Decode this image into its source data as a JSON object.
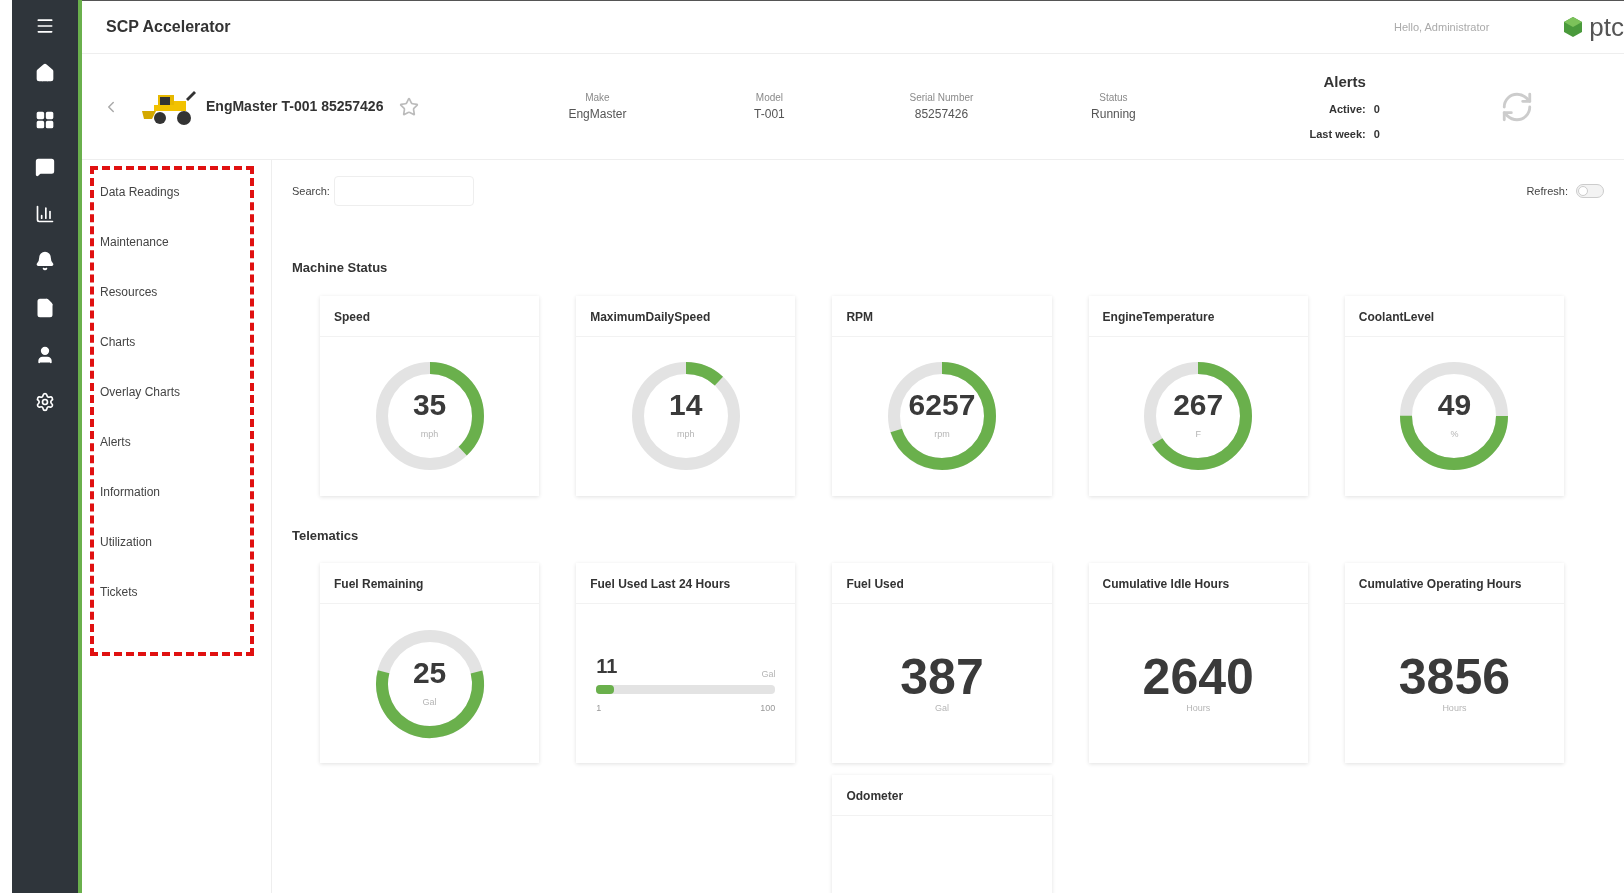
{
  "app": {
    "title": "SCP Accelerator",
    "greeting": "Hello, Administrator",
    "logo_text": "ptc"
  },
  "asset": {
    "name": "EngMaster T-001 85257426",
    "favorite": false,
    "fields": [
      {
        "label": "Make",
        "value": "EngMaster"
      },
      {
        "label": "Model",
        "value": "T-001"
      },
      {
        "label": "Serial Number",
        "value": "85257426"
      },
      {
        "label": "Status",
        "value": "Running"
      }
    ]
  },
  "alerts": {
    "title": "Alerts",
    "rows": [
      {
        "label": "Active:",
        "value": "0"
      },
      {
        "label": "Last week:",
        "value": "0"
      }
    ]
  },
  "menu": [
    "Data Readings",
    "Maintenance",
    "Resources",
    "Charts",
    "Overlay Charts",
    "Alerts",
    "Information",
    "Utilization",
    "Tickets"
  ],
  "search": {
    "label": "Search:"
  },
  "refresh": {
    "label": "Refresh:",
    "on": false
  },
  "sections": [
    {
      "title": "Machine Status",
      "cards": [
        {
          "kind": "ring",
          "title": "Speed",
          "value": "35",
          "unit": "mph",
          "level": 0.38
        },
        {
          "kind": "ring",
          "title": "MaximumDailySpeed",
          "value": "14",
          "unit": "mph",
          "level": 0.12
        },
        {
          "kind": "ring",
          "title": "RPM",
          "value": "6257",
          "unit": "rpm",
          "level": 0.7
        },
        {
          "kind": "ring",
          "title": "EngineTemperature",
          "value": "267",
          "unit": "F",
          "level": 0.66
        },
        {
          "kind": "tank",
          "title": "CoolantLevel",
          "value": "49",
          "unit": "%",
          "level": 0.5
        }
      ]
    },
    {
      "title": "Telematics",
      "cards": [
        {
          "kind": "tank",
          "title": "Fuel Remaining",
          "value": "25",
          "unit": "Gal",
          "level": 0.58
        },
        {
          "kind": "bar",
          "title": "Fuel Used Last 24 Hours",
          "value": "11",
          "unit": "Gal",
          "min": "1",
          "max": "100",
          "level": 0.1
        },
        {
          "kind": "number",
          "title": "Fuel Used",
          "value": "387",
          "unit": "Gal"
        },
        {
          "kind": "number",
          "title": "Cumulative Idle Hours",
          "value": "2640",
          "unit": "Hours"
        },
        {
          "kind": "number",
          "title": "Cumulative Operating Hours",
          "value": "3856",
          "unit": "Hours"
        },
        {
          "kind": "empty",
          "title": "Odometer"
        }
      ]
    }
  ]
}
